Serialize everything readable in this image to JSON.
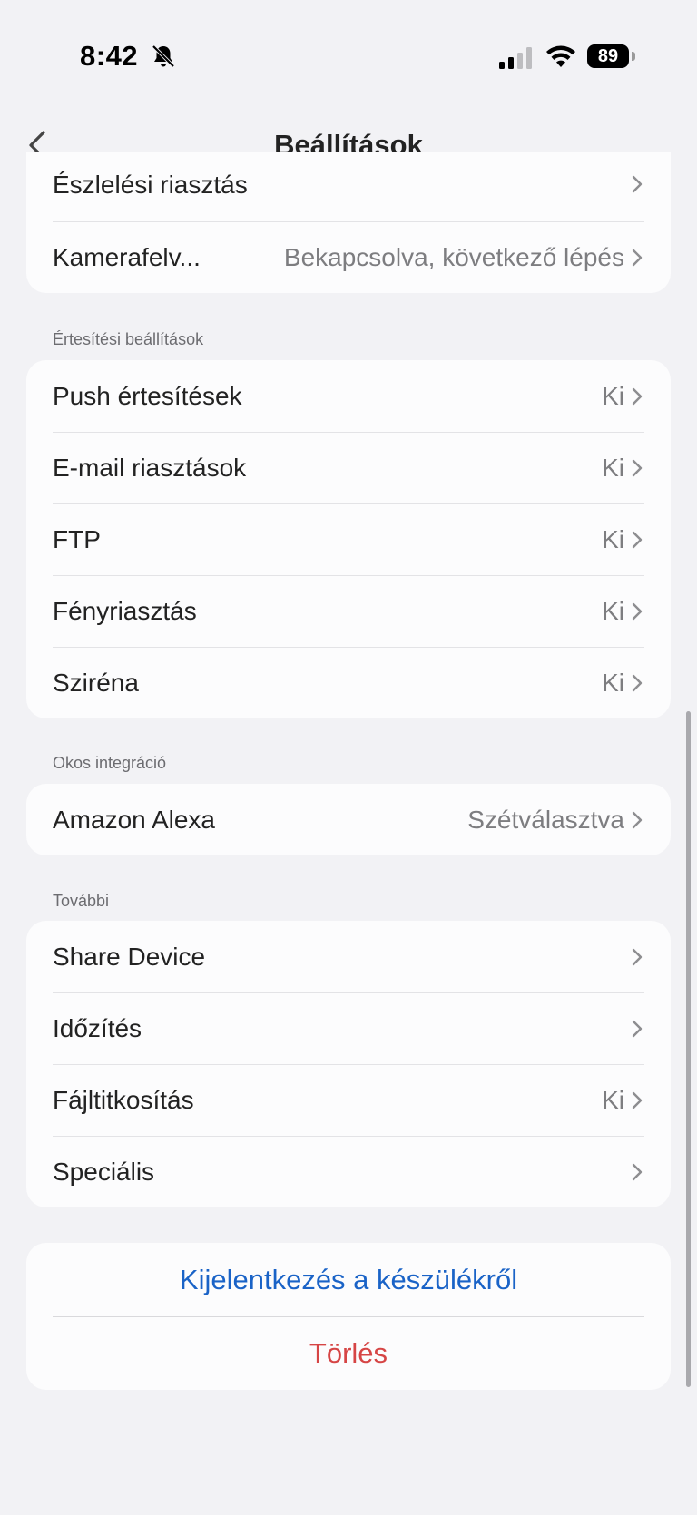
{
  "status_bar": {
    "time": "8:42",
    "battery": "89",
    "icons": [
      "bell-slash-icon",
      "signal-icon",
      "wifi-icon",
      "battery-icon"
    ]
  },
  "nav": {
    "title": "Beállítások",
    "back_icon": "chevron-left-icon"
  },
  "group_top": {
    "rows": [
      {
        "label": "Észlelési riasztás",
        "value": ""
      },
      {
        "label": "Kamerafelv...",
        "value": "Bekapcsolva, következő lépés"
      }
    ]
  },
  "notifications": {
    "header": "Értesítési beállítások",
    "rows": [
      {
        "label": "Push értesítések",
        "value": "Ki"
      },
      {
        "label": "E-mail riasztások",
        "value": "Ki"
      },
      {
        "label": "FTP",
        "value": "Ki"
      },
      {
        "label": "Fényriasztás",
        "value": "Ki"
      },
      {
        "label": "Sziréna",
        "value": "Ki"
      }
    ]
  },
  "smart": {
    "header": "Okos integráció",
    "rows": [
      {
        "label": "Amazon Alexa",
        "value": "Szétválasztva"
      }
    ]
  },
  "more": {
    "header": "További",
    "rows": [
      {
        "label": "Share Device",
        "value": ""
      },
      {
        "label": "Időzítés",
        "value": ""
      },
      {
        "label": "Fájltitkosítás",
        "value": "Ki"
      },
      {
        "label": "Speciális",
        "value": ""
      }
    ]
  },
  "actions": {
    "logout": "Kijelentkezés a készülékről",
    "delete": "Törlés"
  },
  "colors": {
    "background": "#f2f2f5",
    "card": "#fcfcfd",
    "link_blue": "#1a63c7",
    "destructive_red": "#d64545",
    "secondary_text": "#7d7d80"
  }
}
